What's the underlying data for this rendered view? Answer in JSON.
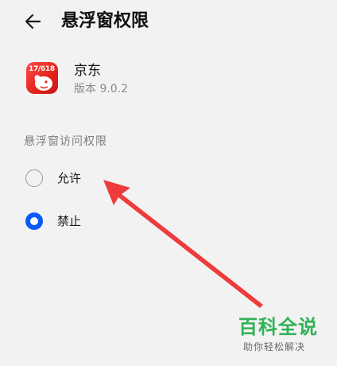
{
  "header": {
    "title": "悬浮窗权限",
    "back_icon": "arrow-left-icon"
  },
  "app": {
    "icon_text": "17/618",
    "name": "京东",
    "version": "版本 9.0.2",
    "icon_colors": [
      "#ff4a4a",
      "#e2231a"
    ]
  },
  "section": {
    "label": "悬浮窗访问权限"
  },
  "options": [
    {
      "label": "允许",
      "selected": false
    },
    {
      "label": "禁止",
      "selected": true
    }
  ],
  "colors": {
    "accent": "#0a59f7",
    "annotation_arrow": "#ee3b3b",
    "watermark": "#2fb356",
    "background": "#f2f2f2"
  },
  "watermark": {
    "title": "百科全说",
    "subtitle": "助你轻松解决"
  }
}
